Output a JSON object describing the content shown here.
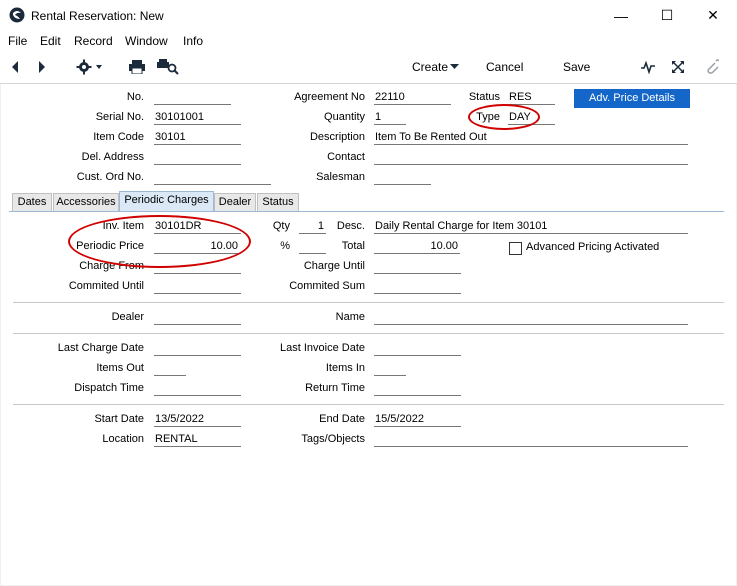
{
  "window": {
    "title": "Rental Reservation: New",
    "minimize": "—",
    "maximize": "☐",
    "close": "✕"
  },
  "menu": [
    "File",
    "Edit",
    "Record",
    "Window",
    "Info"
  ],
  "toolbar": {
    "create": "Create",
    "cancel": "Cancel",
    "save": "Save"
  },
  "header": {
    "no_label": "No.",
    "no_value": "",
    "serial_label": "Serial No.",
    "serial_value": "30101001",
    "item_code_label": "Item Code",
    "item_code_value": "30101",
    "del_address_label": "Del. Address",
    "del_address_value": "",
    "cust_ord_label": "Cust. Ord No.",
    "cust_ord_value": "",
    "agreement_label": "Agreement No",
    "agreement_value": "22110",
    "quantity_label": "Quantity",
    "quantity_value": "1",
    "description_label": "Description",
    "description_value": "Item To Be Rented Out",
    "contact_label": "Contact",
    "contact_value": "",
    "salesman_label": "Salesman",
    "salesman_value": "",
    "status_label": "Status",
    "status_value": "RES",
    "type_label": "Type",
    "type_value": "DAY",
    "adv_price_button": "Adv. Price Details"
  },
  "tabs": [
    "Dates",
    "Accessories",
    "Periodic Charges",
    "Dealer",
    "Status"
  ],
  "periodic": {
    "inv_item_label": "Inv. Item",
    "inv_item_value": "30101DR",
    "periodic_price_label": "Periodic Price",
    "periodic_price_value": "10.00",
    "charge_from_label": "Charge From",
    "charge_from_value": "",
    "commited_until_label": "Commited Until",
    "commited_until_value": "",
    "qty_label": "Qty",
    "qty_value": "1",
    "pct_label": "%",
    "pct_value": "",
    "charge_until_label": "Charge Until",
    "charge_until_value": "",
    "commited_sum_label": "Commited Sum",
    "commited_sum_value": "",
    "desc_label": "Desc.",
    "desc_value": "Daily Rental Charge for Item 30101",
    "total_label": "Total",
    "total_value": "10.00",
    "adv_pricing_label": "Advanced Pricing Activated"
  },
  "dealer": {
    "dealer_label": "Dealer",
    "dealer_value": "",
    "name_label": "Name",
    "name_value": ""
  },
  "charges": {
    "last_charge_label": "Last Charge Date",
    "last_charge_value": "",
    "items_out_label": "Items Out",
    "items_out_value": "",
    "dispatch_label": "Dispatch Time",
    "dispatch_value": "",
    "last_invoice_label": "Last Invoice Date",
    "last_invoice_value": "",
    "items_in_label": "Items In",
    "items_in_value": "",
    "return_label": "Return Time",
    "return_value": ""
  },
  "dates": {
    "start_label": "Start Date",
    "start_value": "13/5/2022",
    "location_label": "Location",
    "location_value": "RENTAL",
    "end_label": "End Date",
    "end_value": "15/5/2022",
    "tags_label": "Tags/Objects",
    "tags_value": ""
  },
  "colors": {
    "accent": "#1467c8",
    "annotation": "#d10000"
  }
}
